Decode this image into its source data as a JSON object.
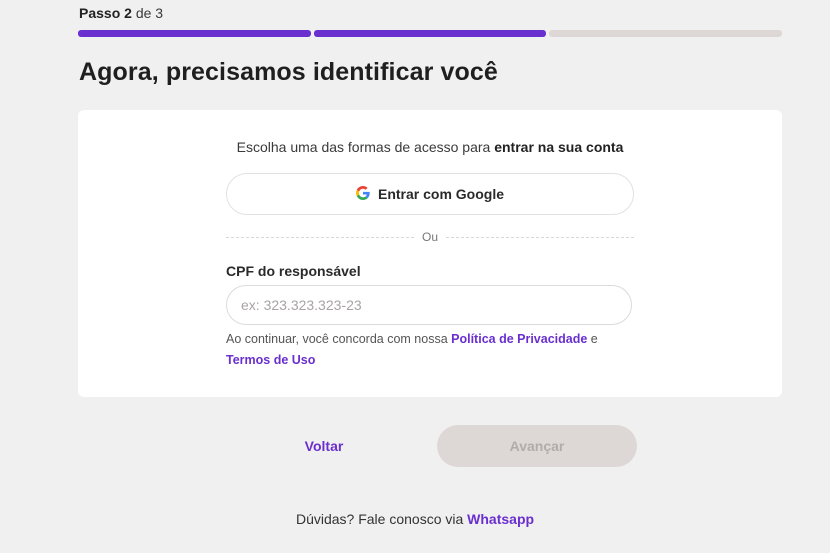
{
  "stepper": {
    "word": "Passo",
    "current": "2",
    "of": "de",
    "total": "3",
    "segments_completed": 2,
    "segments_total": 3
  },
  "page_title": "Agora, precisamos identificar você",
  "card": {
    "intro_text": "Escolha uma das formas de acesso para",
    "intro_bold": "entrar na sua conta",
    "google_button_label": "Entrar com Google",
    "google_icon": "google-icon",
    "divider_text": "Ou",
    "cpf_label": "CPF do responsável",
    "cpf_placeholder": "ex: 323.323.323-23",
    "cpf_value": "",
    "terms_prefix": "Ao continuar, você concorda com nossa",
    "privacy_link": "Política de Privacidade",
    "terms_and": "e",
    "terms_link": "Termos de Uso"
  },
  "actions": {
    "back_label": "Voltar",
    "next_label": "Avançar",
    "next_disabled": true
  },
  "help": {
    "text": "Dúvidas? Fale conosco via",
    "link": "Whatsapp"
  },
  "colors": {
    "accent": "#6a2fcf",
    "background": "#f1f0f0",
    "progress_inactive": "#ddd8d6",
    "disabled_button": "#ddd8d6"
  }
}
